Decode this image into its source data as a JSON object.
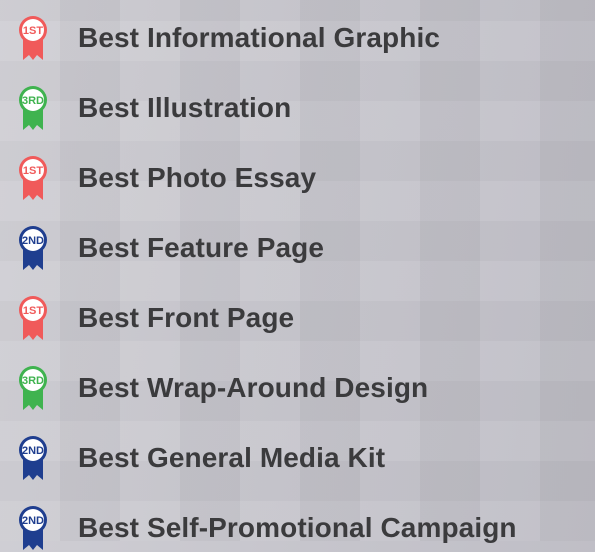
{
  "awards": [
    {
      "label": "Best Informational Graphic",
      "place": "1ST",
      "icon": "first-place-ribbon-icon",
      "color": "#f05a5a"
    },
    {
      "label": "Best Illustration",
      "place": "3RD",
      "icon": "third-place-ribbon-icon",
      "color": "#3fb34f"
    },
    {
      "label": "Best Photo Essay",
      "place": "1ST",
      "icon": "first-place-ribbon-icon",
      "color": "#f05a5a"
    },
    {
      "label": "Best Feature Page",
      "place": "2ND",
      "icon": "second-place-ribbon-icon",
      "color": "#1f3e8f"
    },
    {
      "label": "Best Front Page",
      "place": "1ST",
      "icon": "first-place-ribbon-icon",
      "color": "#f05a5a"
    },
    {
      "label": "Best Wrap-Around Design",
      "place": "3RD",
      "icon": "third-place-ribbon-icon",
      "color": "#3fb34f"
    },
    {
      "label": "Best General Media Kit",
      "place": "2ND",
      "icon": "second-place-ribbon-icon",
      "color": "#1f3e8f"
    },
    {
      "label": "Best Self-Promotional Campaign",
      "place": "2ND",
      "icon": "second-place-ribbon-icon",
      "color": "#1f3e8f"
    }
  ]
}
